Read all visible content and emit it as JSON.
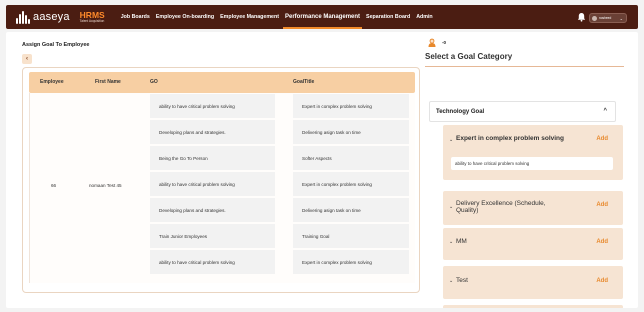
{
  "header": {
    "logo_text": "aaseya",
    "product_title": "HRMS",
    "product_subtitle": "Talent Acquisition",
    "nav": [
      {
        "label": "Job Boards",
        "active": false
      },
      {
        "label": "Employee On-boarding",
        "active": false
      },
      {
        "label": "Employee Management",
        "active": false
      },
      {
        "label": "Performance Management",
        "active": true
      },
      {
        "label": "Separation Board",
        "active": false
      },
      {
        "label": "Admin",
        "active": false
      }
    ],
    "user_name": "nosheed",
    "icons": [
      "bell-icon",
      "chevron-down-icon"
    ]
  },
  "page": {
    "title": "Assign Goal To Employee",
    "back_icon": "chevron-left-icon"
  },
  "table": {
    "columns": [
      "Employee",
      "First Name",
      "GO",
      "GoalTitle"
    ],
    "employee": "66",
    "first_name": "nomaan Test 45",
    "rows": [
      {
        "go": "ability to have critical problem solving",
        "goal_title": "Expert in complex problem solving"
      },
      {
        "go": "Developing plans and strategies.",
        "goal_title": "Delivering asign task on time"
      },
      {
        "go": "Being the Go To Person",
        "goal_title": "Softer Aspects"
      },
      {
        "go": "ability to have critical problem solving",
        "goal_title": "Expert in complex problem solving"
      },
      {
        "go": "Developing plans and strategies.",
        "goal_title": "Delivering asign task on time"
      },
      {
        "go": "Train Junior Employees",
        "goal_title": "Training Goal"
      },
      {
        "go": "ability to have critical problem solving",
        "goal_title": "Expert in complex problem solving"
      }
    ]
  },
  "side": {
    "score": "-0",
    "title": "Select a Goal Category",
    "group_name": "Technology Goal",
    "group_caret": "^",
    "add_label": "Add",
    "goals": [
      {
        "name": "Expert in complex problem solving",
        "expanded": true,
        "detail": "ability to have critical problem solving"
      },
      {
        "name": "Delivery Excellence (Schedule, Quality)",
        "expanded": false
      },
      {
        "name": "MM",
        "expanded": false
      },
      {
        "name": "Test",
        "expanded": false
      }
    ]
  },
  "colors": {
    "topbar": "#4b1d12",
    "accent": "#f28b2b",
    "header_row": "#f7cfa3",
    "goal_card": "#f6e4d3",
    "add_text": "#e8892d"
  }
}
